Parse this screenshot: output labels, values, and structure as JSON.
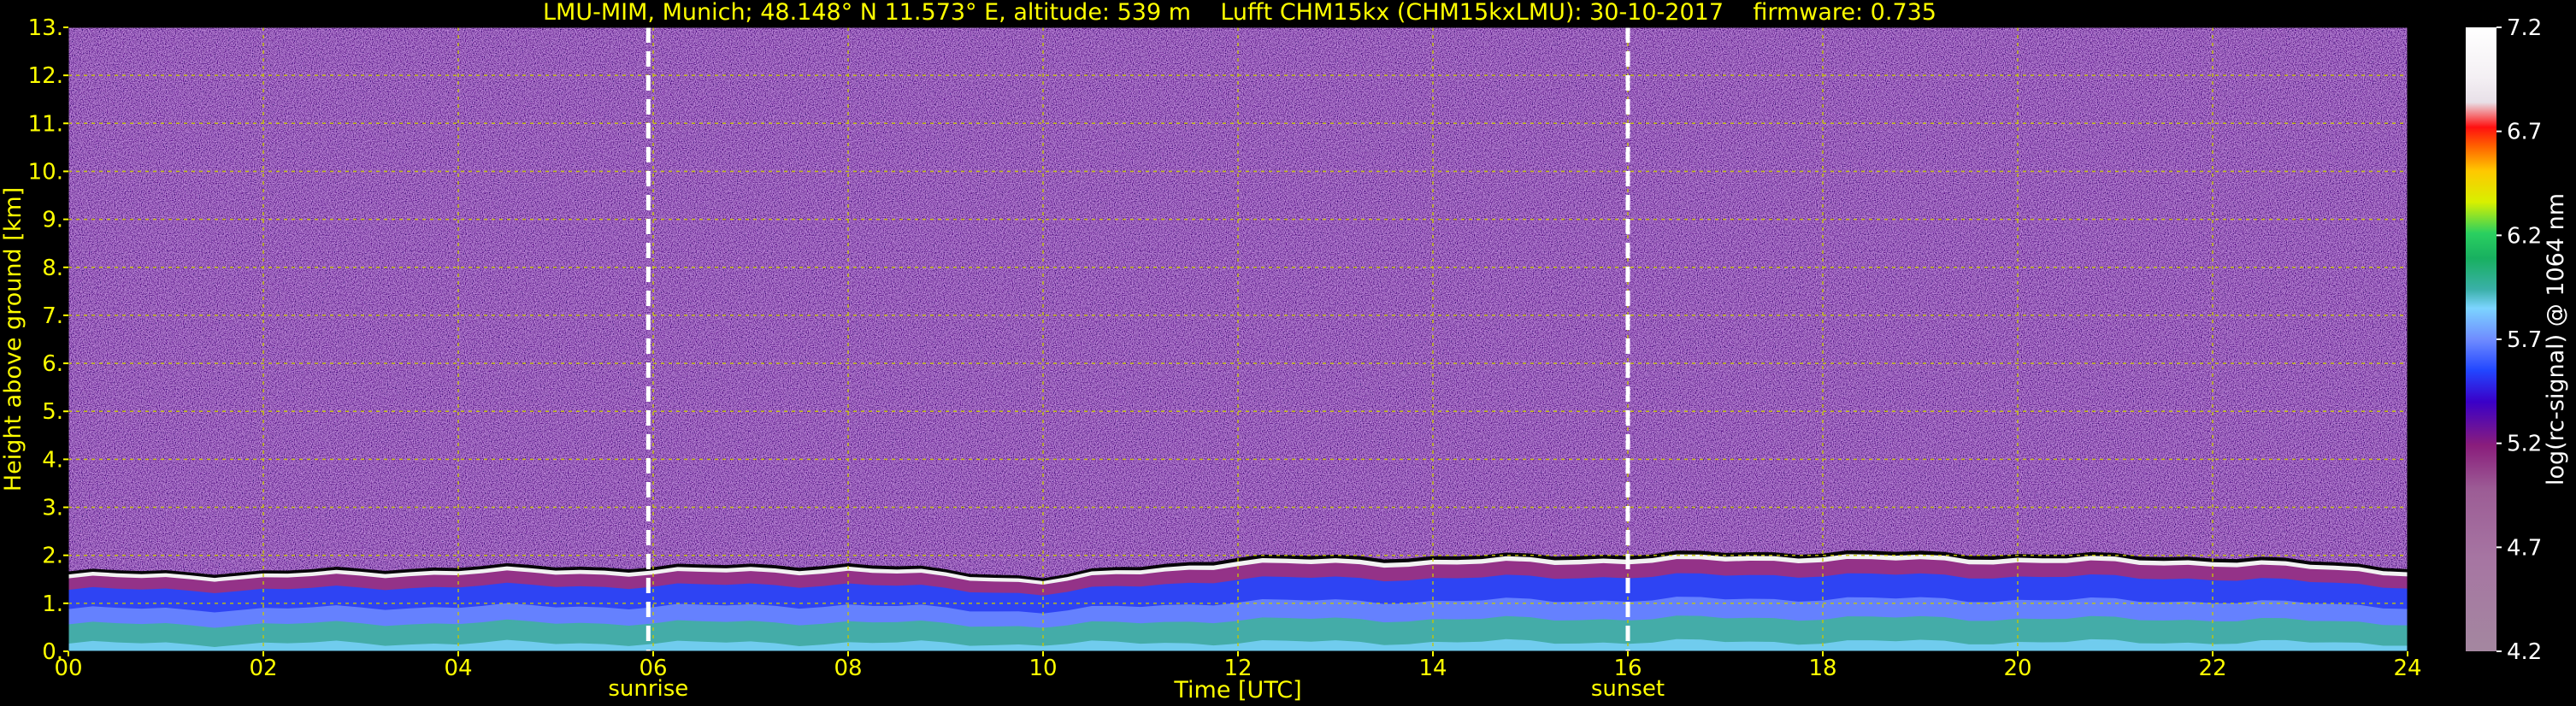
{
  "chart_data": {
    "type": "heatmap",
    "title": "LMU-MIM, Munich; 48.148° N 11.573° E, altitude: 539 m    Lufft CHM15kx (CHM15kxLMU): 30-10-2017    firmware: 0.735",
    "xlabel": "Time [UTC]",
    "ylabel": "Height above ground [km]",
    "colorbar_label": "log(rc-signal) @ 1064 nm",
    "xlim": [
      0,
      24
    ],
    "ylim": [
      0,
      13
    ],
    "x_ticks": [
      "00",
      "02",
      "04",
      "06",
      "08",
      "10",
      "12",
      "14",
      "16",
      "18",
      "20",
      "22",
      "24"
    ],
    "y_ticks": [
      "0.",
      "1.",
      "2.",
      "3.",
      "4.",
      "5.",
      "6.",
      "7.",
      "8.",
      "9.",
      "10.",
      "11.",
      "12.",
      "13."
    ],
    "colorbar_range": [
      4.2,
      7.2
    ],
    "colorbar_ticks": [
      "4.2",
      "4.7",
      "5.2",
      "5.7",
      "6.2",
      "6.7",
      "7.2"
    ],
    "grid": true,
    "markers": [
      {
        "label": "sunrise",
        "x": 5.95
      },
      {
        "label": "sunset",
        "x": 16.0
      }
    ],
    "boundary_layer_top_km": [
      {
        "x": 0,
        "y": 1.6
      },
      {
        "x": 2,
        "y": 1.6
      },
      {
        "x": 4,
        "y": 1.7
      },
      {
        "x": 6,
        "y": 1.7
      },
      {
        "x": 8,
        "y": 1.75
      },
      {
        "x": 10,
        "y": 1.5
      },
      {
        "x": 12,
        "y": 1.9
      },
      {
        "x": 14,
        "y": 1.9
      },
      {
        "x": 16,
        "y": 1.95
      },
      {
        "x": 18,
        "y": 2.0
      },
      {
        "x": 20,
        "y": 1.95
      },
      {
        "x": 22,
        "y": 1.9
      },
      {
        "x": 24,
        "y": 1.7
      }
    ]
  },
  "colors": {
    "axis_text": "#ffff00",
    "grid": "#c8c800",
    "background": "#000000",
    "colorbar": [
      "#a487a0",
      "#9c5c95",
      "#8a1d7c",
      "#3a00c8",
      "#2246ff",
      "#6f8cff",
      "#7cd4ff",
      "#18b060",
      "#2ad060",
      "#d8f000",
      "#ffc800",
      "#ff6000",
      "#ff1010",
      "#e8e0e8",
      "#ffffff"
    ]
  }
}
